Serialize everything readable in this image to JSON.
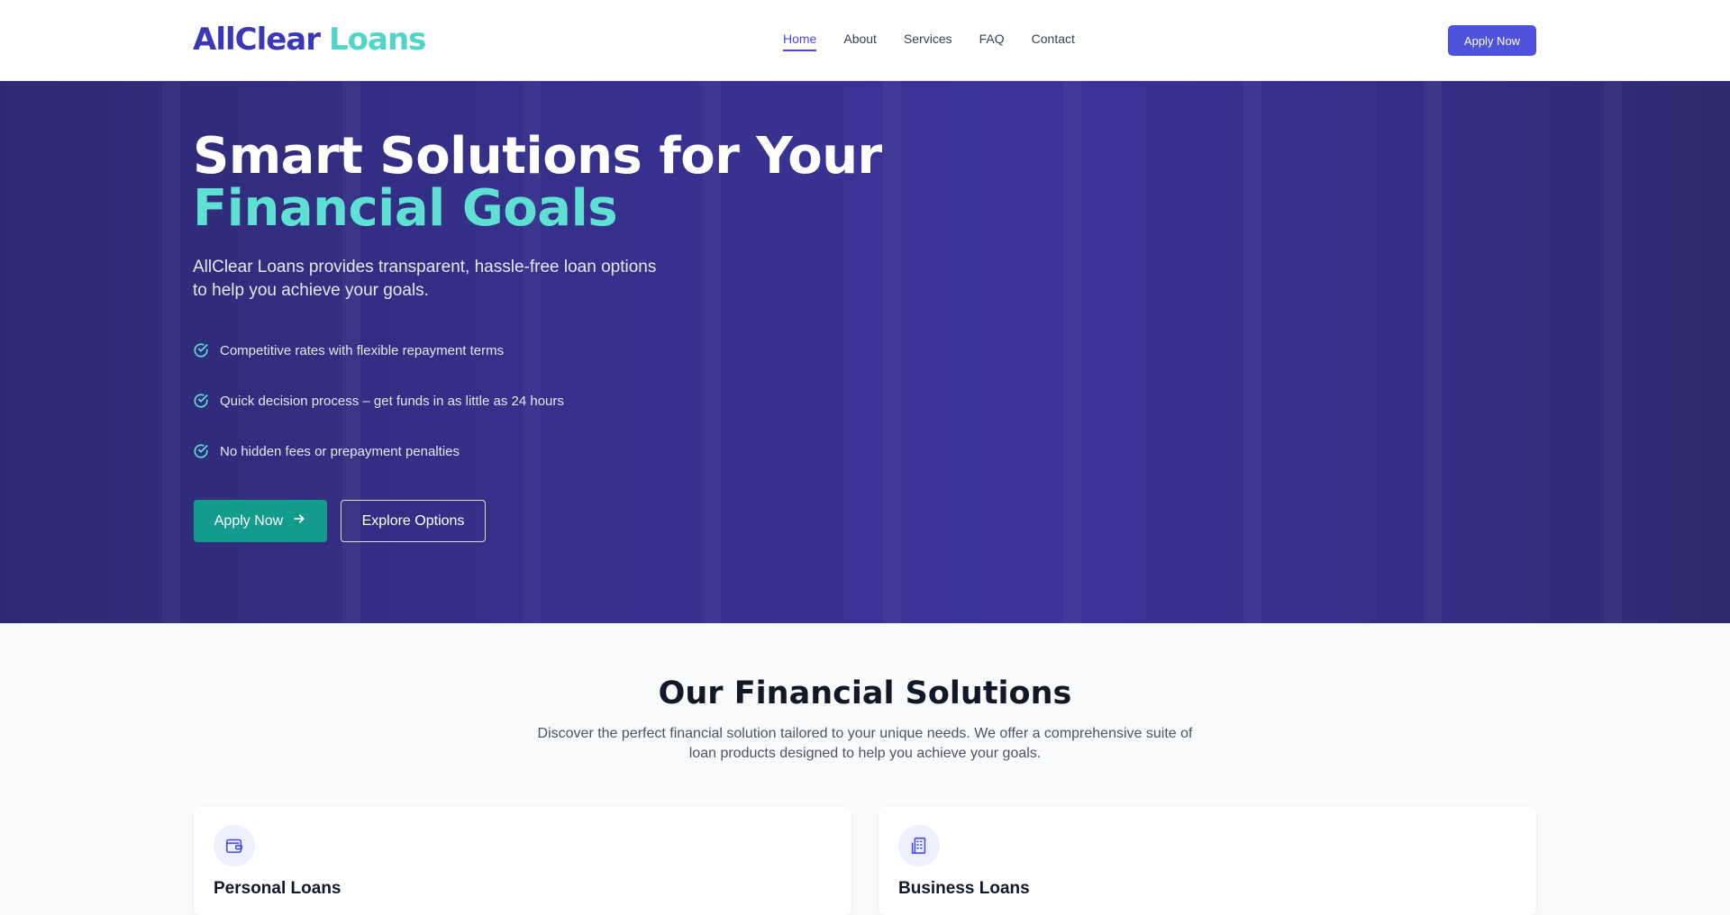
{
  "header": {
    "logo": {
      "part1": "AllClear",
      "part2": "Loans"
    },
    "nav": [
      {
        "label": "Home",
        "active": true
      },
      {
        "label": "About",
        "active": false
      },
      {
        "label": "Services",
        "active": false
      },
      {
        "label": "FAQ",
        "active": false
      },
      {
        "label": "Contact",
        "active": false
      }
    ],
    "cta_label": "Apply Now"
  },
  "hero": {
    "title_line1": "Smart Solutions for Your",
    "title_line2": "Financial Goals",
    "subtitle": "AllClear Loans provides transparent, hassle-free loan options to help you achieve your goals.",
    "features": [
      "Competitive rates with flexible repayment terms",
      "Quick decision process – get funds in as little as 24 hours",
      "No hidden fees or prepayment penalties"
    ],
    "primary_button": "Apply Now",
    "secondary_button": "Explore Options"
  },
  "solutions": {
    "title": "Our Financial Solutions",
    "description": "Discover the perfect financial solution tailored to your unique needs. We offer a comprehensive suite of loan products designed to help you achieve your goals.",
    "cards": [
      {
        "title": "Personal Loans",
        "icon": "wallet-icon"
      },
      {
        "title": "Business Loans",
        "icon": "building-icon"
      }
    ]
  },
  "colors": {
    "brand_primary": "#4f52dd",
    "brand_accent": "#5ee1d2",
    "hero_bg": "#35308a",
    "cta_green": "#139b8c"
  }
}
